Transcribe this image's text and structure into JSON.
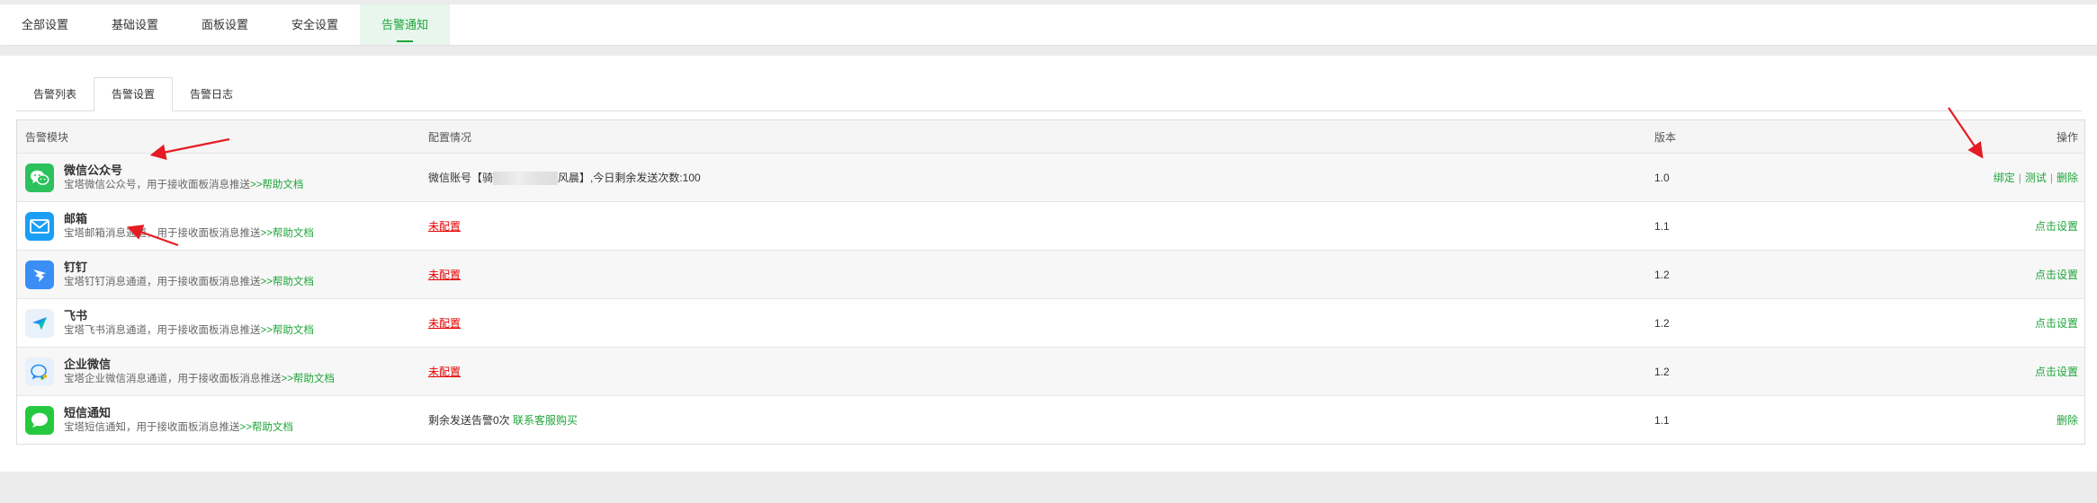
{
  "top_tabs": [
    "全部设置",
    "基础设置",
    "面板设置",
    "安全设置",
    "告警通知"
  ],
  "sub_tabs": [
    "告警列表",
    "告警设置",
    "告警日志"
  ],
  "table": {
    "headers": [
      "告警模块",
      "配置情况",
      "版本",
      "操作"
    ],
    "rows": [
      {
        "icon": "wechat-mp-icon",
        "name": "微信公众号",
        "desc": "宝塔微信公众号，用于接收面板消息推送",
        "help": ">>帮助文档",
        "config_prefix": "微信账号【骑",
        "config_suffix": "风晨】,今日剩余发送次数:100",
        "version": "1.0",
        "actions": [
          "绑定",
          "测试",
          "删除"
        ]
      },
      {
        "icon": "mail-icon",
        "name": "邮箱",
        "desc": "宝塔邮箱消息通道，用于接收面板消息推送",
        "help": ">>帮助文档",
        "config": "未配置",
        "version": "1.1",
        "action": "点击设置"
      },
      {
        "icon": "dingtalk-icon",
        "name": "钉钉",
        "desc": "宝塔钉钉消息通道，用于接收面板消息推送",
        "help": ">>帮助文档",
        "config": "未配置",
        "version": "1.2",
        "action": "点击设置"
      },
      {
        "icon": "feishu-icon",
        "name": "飞书",
        "desc": "宝塔飞书消息通道，用于接收面板消息推送",
        "help": ">>帮助文档",
        "config": "未配置",
        "version": "1.2",
        "action": "点击设置"
      },
      {
        "icon": "wecom-icon",
        "name": "企业微信",
        "desc": "宝塔企业微信消息通道，用于接收面板消息推送",
        "help": ">>帮助文档",
        "config": "未配置",
        "version": "1.2",
        "action": "点击设置"
      },
      {
        "icon": "sms-icon",
        "name": "短信通知",
        "desc": "宝塔短信通知，用于接收面板消息推送",
        "help": ">>帮助文档",
        "config_prefix": "剩余发送告警0次",
        "config_link": "联系客服购买",
        "version": "1.1",
        "action": "删除"
      }
    ]
  },
  "colors": {
    "accent": "#20a53a",
    "unset": "#e60000",
    "annotation": "#e51c23"
  }
}
